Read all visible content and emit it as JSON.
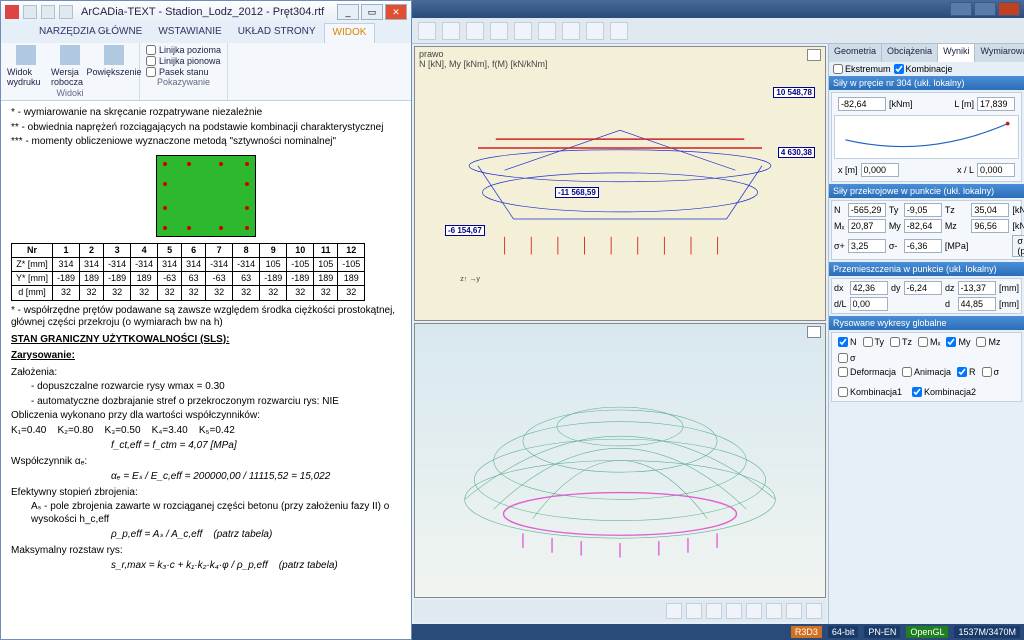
{
  "left": {
    "title": "ArCADia-TEXT - Stadion_Lodz_2012 - Pręt304.rtf",
    "tabs": [
      "NARZĘDZIA GŁÓWNE",
      "WSTAWIANIE",
      "UKŁAD STRONY",
      "WIDOK"
    ],
    "active_tab": "WIDOK",
    "ribbon": {
      "group1": {
        "t1": "Widok wydruku",
        "t2": "Wersja robocza",
        "t3": "Powiększenie",
        "label": "Widoki"
      },
      "group2": {
        "c1": "Linijka pozioma",
        "c2": "Linijka pionowa",
        "c3": "Pasek stanu",
        "label": "Pokazywanie"
      }
    },
    "doc": {
      "note1": "* - wymiarowanie na skręcanie rozpatrywane niezależnie",
      "note2": "** - obwiednia naprężeń rozciągających na podstawie kombinacji charakterystycznej",
      "note3": "*** - momenty obliczeniowe wyznaczone metodą \"sztywności nominalnej\"",
      "table": {
        "h_nr": "Nr",
        "c1": "1",
        "c2": "2",
        "c3": "3",
        "c4": "4",
        "c5": "5",
        "c6": "6",
        "c7": "7",
        "c8": "8",
        "c9": "9",
        "c10": "10",
        "c11": "11",
        "c12": "12",
        "r1": "Z* [mm]",
        "r1v": [
          "314",
          "314",
          "-314",
          "-314",
          "314",
          "314",
          "-314",
          "-314",
          "105",
          "-105",
          "105",
          "-105"
        ],
        "r2": "Y* [mm]",
        "r2v": [
          "-189",
          "189",
          "-189",
          "189",
          "-63",
          "63",
          "-63",
          "63",
          "-189",
          "-189",
          "189",
          "189"
        ],
        "r3": "d [mm]",
        "r3v": [
          "32",
          "32",
          "32",
          "32",
          "32",
          "32",
          "32",
          "32",
          "32",
          "32",
          "32",
          "32"
        ]
      },
      "tnote": "* - współrzędne prętów podawane są zawsze względem środka ciężkości prostokątnej, głównej części przekroju (o wymiarach bw na h)",
      "sls_h": "STAN GRANICZNY UŻYTKOWALNOŚCI (SLS):",
      "zar": "Zarysowanie:",
      "zal": "Założenia:",
      "zal1": "dopuszczalne rozwarcie rysy wmax = 0.30",
      "zal2": "automatyczne dozbrajanie stref o przekroczonym rozwarciu rys: NIE",
      "obl": "Obliczenia wykonano przy dla wartości współczynników:",
      "k1": "K₁=0.40",
      "k2": "K₂=0.80",
      "k3": "K₃=0.50",
      "k4": "K₄=3.40",
      "k5": "K₅=0.42",
      "f1": "f_ct,eff = f_ctm = 4,07 [MPa]",
      "wsp": "Współczynnik αₑ:",
      "f2": "αₑ = Eₛ / E_c,eff = 200000,00 / 11115,52 = 15,022",
      "ef": "Efektywny stopień zbrojenia:",
      "ef1": "Aₛ - pole zbrojenia zawarte w rozciąganej części betonu (przy założeniu fazy II) o wysokości h_c,eff",
      "f3": "ρ_p,eff = Aₛ / A_c,eff",
      "patrz": "(patrz tabela)",
      "mrs": "Maksymalny rozstaw rys:",
      "f4": "s_r,max = k₃·c + k₁·k₂·k₄·φ / ρ_p,eff"
    }
  },
  "right": {
    "toolbar_hint": "prawo",
    "toolbar_sub": "N [kN], My [kNm], f(M) [kN/kNm]",
    "labels": {
      "l1": "10 548,78",
      "l2": "4 630,38",
      "l3": "-11 568,59",
      "l4": "-6 154,67"
    },
    "props": {
      "tabs": [
        "Geometria",
        "Obciążenia",
        "Wyniki",
        "Wymiarowanie"
      ],
      "active": "Wyniki",
      "ext": "Ekstremum",
      "komb": "Kombinacje",
      "h1": "Siły w pręcie nr 304 (ukł. lokalny)",
      "g": "-82,64",
      "g_unit": "[kNm]",
      "L": "L [m]",
      "Lv": "17,839",
      "xm": "x [m]",
      "xmv": "0,000",
      "xL": "x / L",
      "xLv": "0,000",
      "h2": "Siły przekrojowe w punkcie (ukł. lokalny)",
      "N": "N",
      "Nv": "-565,29",
      "Ty": "Ty",
      "Tyv": "-9,05",
      "Tz": "Tz",
      "Tzv": "35,04",
      "u1": "[kN]",
      "Mx": "Mₓ",
      "Mxv": "20,87",
      "My": "My",
      "Myv": "-82,64",
      "Mz": "Mz",
      "Mzv": "96,56",
      "u2": "[kNm]",
      "sp": "σ+",
      "spv": "3,25",
      "sm": "σ-",
      "smv": "-6,36",
      "u3": "[MPa]",
      "sg": "σ (p)",
      "h3": "Przemieszczenia w punkcie (ukł. lokalny)",
      "dx": "dx",
      "dxv": "42,36",
      "dy": "dy",
      "dyv": "-6,24",
      "dz": "dz",
      "dzv": "-13,37",
      "u4": "[mm]",
      "dL": "d/L",
      "dLv": "0,00",
      "d": "d",
      "dv": "44,85",
      "u5": "[mm]",
      "h4": "Rysowane wykresy globalne",
      "cN": "N",
      "cTy": "Ty",
      "cTz": "Tz",
      "cMx": "Mₓ",
      "cMy": "My",
      "cMz": "Mz",
      "cS": "σ",
      "cDef": "Deformacja",
      "cAni": "Animacja",
      "cR": "R",
      "cSg": "σ",
      "k1": "Kombinacja1",
      "k2": "Kombinacja2"
    },
    "status": {
      "s1": "R3D3",
      "s2": "64-bit",
      "s3": "PN-EN",
      "s4": "OpenGL",
      "s5": "1537M/3470M"
    }
  }
}
